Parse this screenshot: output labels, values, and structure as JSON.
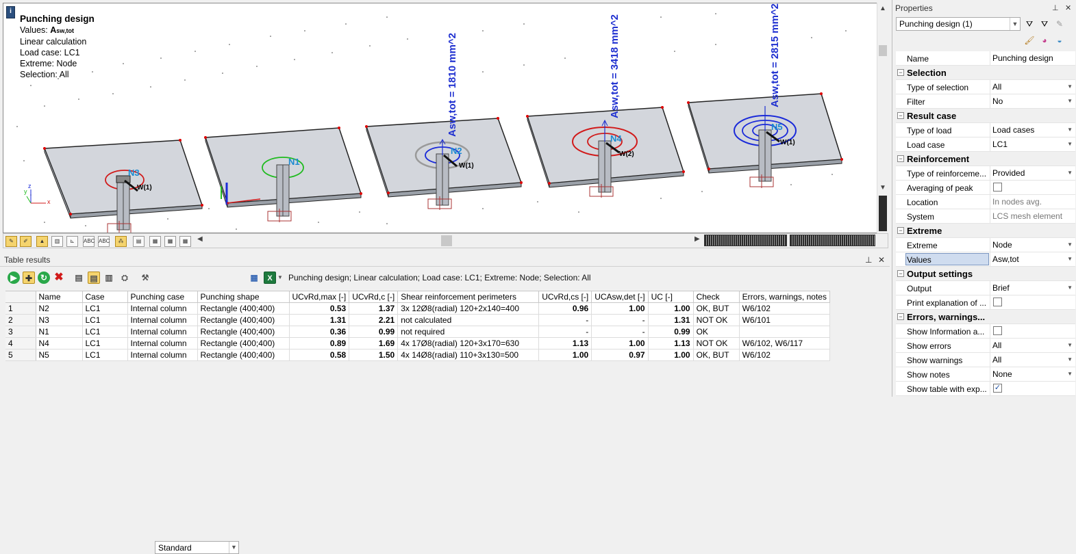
{
  "viewport": {
    "info_button": "i",
    "info_title": "Punching design",
    "info_values_prefix": "Values: ",
    "info_values_main": "A",
    "info_values_sub": "sw,tot",
    "info_lines": [
      "Linear calculation",
      "Load case: LC1",
      "Extreme: Node",
      "Selection: All"
    ],
    "annotations": [
      "Asw,tot = 1810 mm^2",
      "Asw,tot = 3418 mm^2",
      "Asw,tot = 2815 mm^2"
    ],
    "node_labels": [
      "N3",
      "N1",
      "N2",
      "N4",
      "N5"
    ],
    "load_labels": [
      "W(1)",
      "W(1)",
      "W(2)",
      "W(1)"
    ],
    "axis_labels": {
      "z": "z",
      "x": "x",
      "y": "y"
    }
  },
  "view_toolbar": {
    "icons": [
      "pen-icon",
      "pen-filled-icon",
      "structure-icon",
      "chart-icon",
      "axis-icon",
      "label-abc-icon",
      "label-abc2-icon",
      "mesh-icon",
      "book-icon",
      "grid-a-icon",
      "grid-b-icon",
      "grid-c-icon"
    ]
  },
  "table_panel": {
    "title": "Table results",
    "pin": "⊥",
    "close": "✕",
    "preset": "Standard",
    "summary": "Punching design; Linear calculation; Load case: LC1; Extreme: Node; Selection: All",
    "columns": [
      "",
      "Name",
      "Case",
      "Punching case",
      "Punching shape",
      "UCvRd,max [-]",
      "UCvRd,c [-]",
      "Shear reinforcement perimeters",
      "UCvRd,cs [-]",
      "UCAsw,det [-]",
      "UC [-]",
      "Check",
      "Errors, warnings, notes"
    ],
    "rows": [
      [
        "1",
        "N2",
        "LC1",
        "Internal column",
        "Rectangle (400;400)",
        "0.53",
        "1.37",
        "3x 12Ø8(radial) 120+2x140=400",
        "0.96",
        "1.00",
        "1.00",
        "OK, BUT",
        "W6/102"
      ],
      [
        "2",
        "N3",
        "LC1",
        "Internal column",
        "Rectangle (400;400)",
        "1.31",
        "2.21",
        "not calculated",
        "-",
        "-",
        "1.31",
        "NOT OK",
        "W6/101"
      ],
      [
        "3",
        "N1",
        "LC1",
        "Internal column",
        "Rectangle (400;400)",
        "0.36",
        "0.99",
        "not required",
        "-",
        "-",
        "0.99",
        "OK",
        ""
      ],
      [
        "4",
        "N4",
        "LC1",
        "Internal column",
        "Rectangle (400;400)",
        "0.89",
        "1.69",
        "4x 17Ø8(radial) 120+3x170=630",
        "1.13",
        "1.00",
        "1.13",
        "NOT OK",
        "W6/102, W6/117"
      ],
      [
        "5",
        "N5",
        "LC1",
        "Internal column",
        "Rectangle (400;400)",
        "0.58",
        "1.50",
        "4x 14Ø8(radial) 110+3x130=500",
        "1.00",
        "0.97",
        "1.00",
        "OK, BUT",
        "W6/102"
      ]
    ]
  },
  "properties": {
    "title": "Properties",
    "pin": "⊥",
    "close": "✕",
    "selector": "Punching design (1)",
    "rows": [
      {
        "type": "row",
        "key": "Name",
        "value": "Punching design"
      },
      {
        "type": "group",
        "key": "Selection"
      },
      {
        "type": "row",
        "key": "Type of selection",
        "value": "All",
        "dd": true
      },
      {
        "type": "row",
        "key": "Filter",
        "value": "No",
        "dd": true
      },
      {
        "type": "group",
        "key": "Result case"
      },
      {
        "type": "row",
        "key": "Type of load",
        "value": "Load cases",
        "dd": true
      },
      {
        "type": "row",
        "key": "Load case",
        "value": "LC1",
        "dd": true
      },
      {
        "type": "group",
        "key": "Reinforcement"
      },
      {
        "type": "row",
        "key": "Type of reinforceme...",
        "value": "Provided",
        "dd": true
      },
      {
        "type": "check",
        "key": "Averaging of peak",
        "checked": false
      },
      {
        "type": "row",
        "key": "Location",
        "value": "In nodes avg.",
        "ro": true
      },
      {
        "type": "row",
        "key": "System",
        "value": "LCS mesh element",
        "ro": true
      },
      {
        "type": "group",
        "key": "Extreme"
      },
      {
        "type": "row",
        "key": "Extreme",
        "value": "Node",
        "dd": true
      },
      {
        "type": "row",
        "key": "Values",
        "value": "Asw,tot",
        "dd": true,
        "sel": true
      },
      {
        "type": "group",
        "key": "Output settings"
      },
      {
        "type": "row",
        "key": "Output",
        "value": "Brief",
        "dd": true
      },
      {
        "type": "check",
        "key": "Print explanation of ...",
        "checked": false
      },
      {
        "type": "group",
        "key": "Errors, warnings..."
      },
      {
        "type": "check",
        "key": "Show Information a...",
        "checked": false
      },
      {
        "type": "row",
        "key": "Show errors",
        "value": "All",
        "dd": true
      },
      {
        "type": "row",
        "key": "Show warnings",
        "value": "All",
        "dd": true
      },
      {
        "type": "row",
        "key": "Show notes",
        "value": "None",
        "dd": true
      },
      {
        "type": "check",
        "key": "Show table with exp...",
        "checked": true
      }
    ]
  },
  "colors": {
    "slab_fill": "#d3d6dc",
    "annotation_blue": "#1e2fd0",
    "node_label": "#1b8ad1",
    "contour_red": "#d11a1a",
    "contour_green": "#1fbb1f",
    "contour_blue": "#1a2ad9",
    "toolbar_active": "#f5d46e"
  }
}
